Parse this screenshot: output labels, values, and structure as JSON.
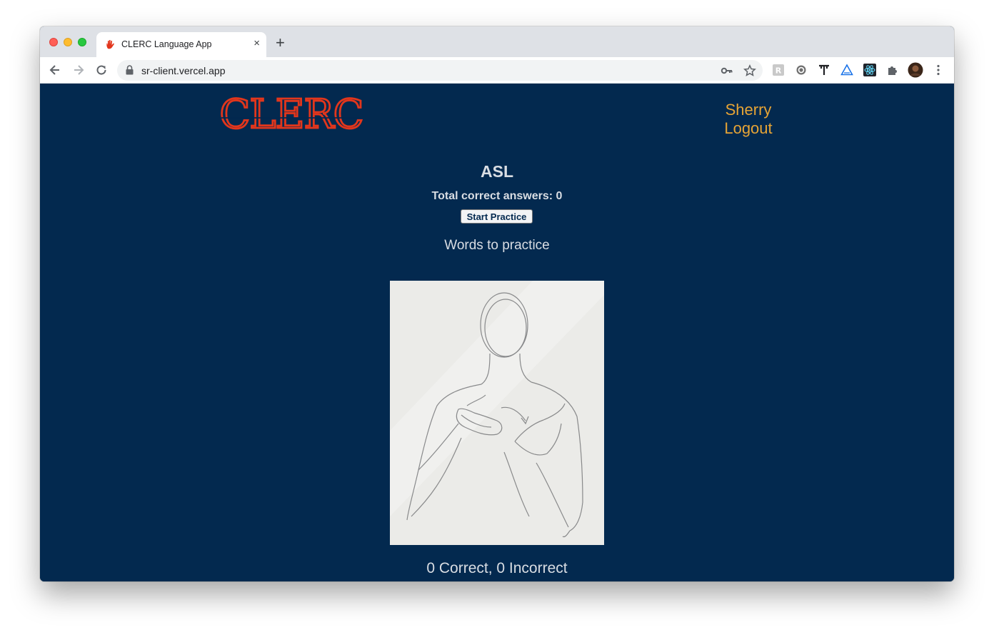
{
  "browser": {
    "tab_title": "CLERC Language App",
    "tab_close": "×",
    "new_tab": "+",
    "url": "sr-client.vercel.app",
    "icons": [
      "back-icon",
      "forward-icon",
      "reload-icon",
      "lock-icon",
      "key-icon",
      "star-icon",
      "extensions-icon",
      "profile-avatar",
      "more-icon"
    ]
  },
  "header": {
    "logo_text": "CLERC",
    "logo_color": "#e2361c",
    "username": "Sherry",
    "logout_label": "Logout",
    "link_color": "#e6a435"
  },
  "main": {
    "language_name": "ASL",
    "total_correct": "Total correct answers: 0",
    "start_button": "Start Practice",
    "words_heading": "Words to practice",
    "score_line": "0 Correct, 0 Incorrect",
    "background_color": "#03294f"
  }
}
